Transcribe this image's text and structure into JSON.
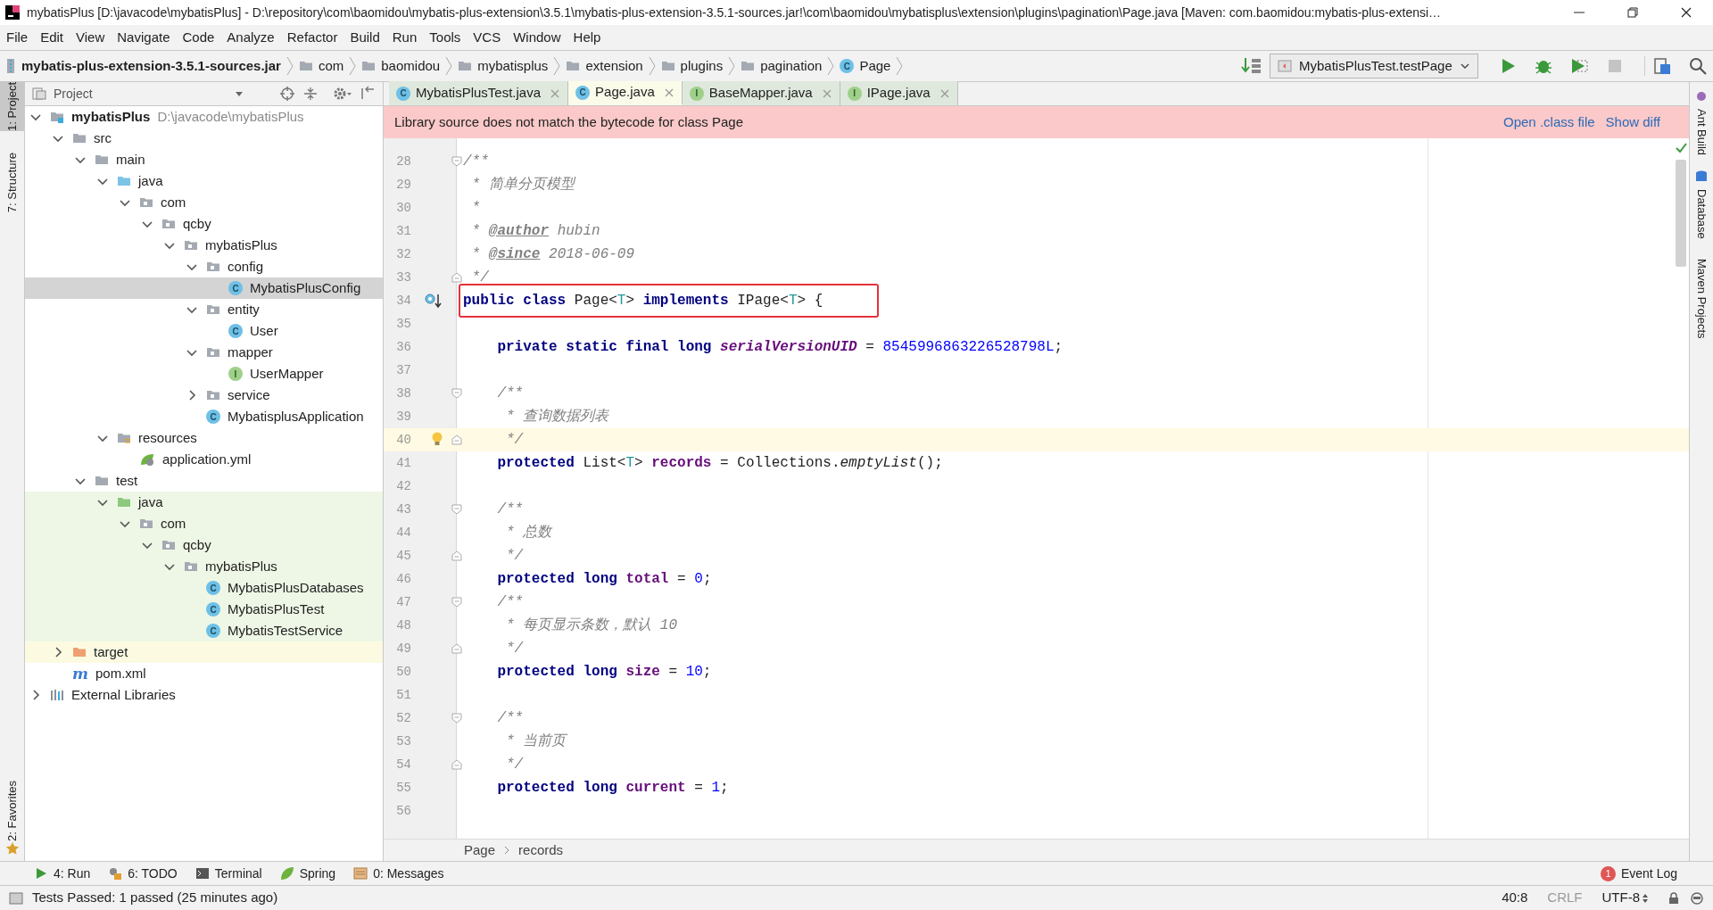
{
  "window": {
    "title": "mybatisPlus [D:\\javacode\\mybatisPlus] - D:\\repository\\com\\baomidou\\mybatis-plus-extension\\3.5.1\\mybatis-plus-extension-3.5.1-sources.jar!\\com\\baomidou\\mybatisplus\\extension\\plugins\\pagination\\Page.java [Maven: com.baomidou:mybatis-plus-extensi…"
  },
  "menu": [
    "File",
    "Edit",
    "View",
    "Navigate",
    "Code",
    "Analyze",
    "Refactor",
    "Build",
    "Run",
    "Tools",
    "VCS",
    "Window",
    "Help"
  ],
  "nav_bar": {
    "items": [
      {
        "label": "mybatis-plus-extension-3.5.1-sources.jar",
        "kind": "jar"
      },
      {
        "label": "com",
        "kind": "folder"
      },
      {
        "label": "baomidou",
        "kind": "folder"
      },
      {
        "label": "mybatisplus",
        "kind": "folder"
      },
      {
        "label": "extension",
        "kind": "folder"
      },
      {
        "label": "plugins",
        "kind": "folder"
      },
      {
        "label": "pagination",
        "kind": "folder"
      },
      {
        "label": "Page",
        "kind": "class",
        "icon_letter": "C"
      }
    ],
    "run_config": "MybatisPlusTest.testPage"
  },
  "left_strip": {
    "top": [
      {
        "label": "1: Project",
        "selected": true
      },
      {
        "label": "7: Structure",
        "selected": false
      }
    ],
    "bottom": [
      {
        "label": "2: Favorites",
        "selected": false
      }
    ]
  },
  "project_panel": {
    "title": "Project",
    "tree": [
      {
        "label": "mybatisPlus",
        "hint": "D:\\javacode\\mybatisPlus",
        "kind": "module",
        "expanded": true,
        "selected": false,
        "children": [
          {
            "label": "src",
            "kind": "folder",
            "expanded": true,
            "selected": false,
            "children": [
              {
                "label": "main",
                "kind": "folder",
                "expanded": true,
                "selected": false,
                "children": [
                  {
                    "label": "java",
                    "kind": "source-folder",
                    "expanded": true,
                    "selected": false,
                    "children": [
                      {
                        "label": "com",
                        "kind": "package",
                        "expanded": true,
                        "selected": false,
                        "children": [
                          {
                            "label": "qcby",
                            "kind": "package",
                            "expanded": true,
                            "selected": false,
                            "children": [
                              {
                                "label": "mybatisPlus",
                                "kind": "package",
                                "expanded": true,
                                "selected": false,
                                "children": [
                                  {
                                    "label": "config",
                                    "kind": "package",
                                    "expanded": true,
                                    "selected": false,
                                    "children": [
                                      {
                                        "label": "MybatisPlusConfig",
                                        "kind": "class",
                                        "icon_letter": "C",
                                        "selected": true
                                      }
                                    ]
                                  },
                                  {
                                    "label": "entity",
                                    "kind": "package",
                                    "expanded": true,
                                    "selected": false,
                                    "children": [
                                      {
                                        "label": "User",
                                        "kind": "class",
                                        "icon_letter": "C",
                                        "selected": false
                                      }
                                    ]
                                  },
                                  {
                                    "label": "mapper",
                                    "kind": "package",
                                    "expanded": true,
                                    "selected": false,
                                    "children": [
                                      {
                                        "label": "UserMapper",
                                        "kind": "interface",
                                        "icon_letter": "I",
                                        "selected": false
                                      }
                                    ]
                                  },
                                  {
                                    "label": "service",
                                    "kind": "package",
                                    "expanded": false,
                                    "selected": false
                                  },
                                  {
                                    "label": "MybatisplusApplication",
                                    "kind": "spring-class",
                                    "icon_letter": "C",
                                    "selected": false
                                  }
                                ]
                              }
                            ]
                          }
                        ]
                      }
                    ]
                  },
                  {
                    "label": "resources",
                    "kind": "resources-folder",
                    "expanded": true,
                    "selected": false,
                    "children": [
                      {
                        "label": "application.yml",
                        "kind": "yml",
                        "selected": false
                      }
                    ]
                  }
                ]
              },
              {
                "label": "test",
                "kind": "folder",
                "expanded": true,
                "selected": false,
                "children": [
                  {
                    "label": "java",
                    "kind": "test-folder",
                    "expanded": true,
                    "selected": false,
                    "test_scope": true,
                    "children": [
                      {
                        "label": "com",
                        "kind": "package",
                        "expanded": true,
                        "selected": false,
                        "test_scope": true,
                        "children": [
                          {
                            "label": "qcby",
                            "kind": "package",
                            "expanded": true,
                            "selected": false,
                            "test_scope": true,
                            "children": [
                              {
                                "label": "mybatisPlus",
                                "kind": "package",
                                "expanded": true,
                                "selected": false,
                                "test_scope": true,
                                "children": [
                                  {
                                    "label": "MybatisPlusDatabases",
                                    "kind": "test-class",
                                    "icon_letter": "C",
                                    "selected": false,
                                    "test_scope": true
                                  },
                                  {
                                    "label": "MybatisPlusTest",
                                    "kind": "test-class",
                                    "icon_letter": "C",
                                    "selected": false,
                                    "test_scope": true
                                  },
                                  {
                                    "label": "MybatisTestService",
                                    "kind": "test-class",
                                    "icon_letter": "C",
                                    "selected": false,
                                    "test_scope": true
                                  }
                                ]
                              }
                            ]
                          }
                        ]
                      }
                    ]
                  }
                ]
              }
            ]
          },
          {
            "label": "target",
            "kind": "excluded-folder",
            "expanded": false,
            "selected": false,
            "excluded": true
          },
          {
            "label": "pom.xml",
            "kind": "maven",
            "icon_letter": "m",
            "selected": false
          }
        ]
      },
      {
        "label": "External Libraries",
        "kind": "libraries",
        "expanded": false,
        "selected": false
      }
    ]
  },
  "editor": {
    "tabs": [
      {
        "label": "MybatisPlusTest.java",
        "kind": "test-class",
        "icon_letter": "C",
        "selected": false
      },
      {
        "label": "Page.java",
        "kind": "class",
        "icon_letter": "C",
        "selected": true
      },
      {
        "label": "BaseMapper.java",
        "kind": "interface",
        "icon_letter": "I",
        "selected": false
      },
      {
        "label": "IPage.java",
        "kind": "interface",
        "icon_letter": "I",
        "selected": false
      }
    ],
    "banner": {
      "message": "Library source does not match the bytecode for class Page",
      "links": [
        "Open .class file",
        "Show diff"
      ]
    },
    "lines": [
      {
        "n": "28",
        "current": false,
        "boxed": false,
        "fold_start": true,
        "tokens": [
          {
            "kind": "comment",
            "t": "/**"
          }
        ]
      },
      {
        "n": "29",
        "current": false,
        "boxed": false,
        "tokens": [
          {
            "kind": "comment",
            "t": " * 简单分页模型"
          }
        ]
      },
      {
        "n": "30",
        "current": false,
        "boxed": false,
        "tokens": [
          {
            "kind": "comment",
            "t": " *"
          }
        ]
      },
      {
        "n": "31",
        "current": false,
        "boxed": false,
        "tokens": [
          {
            "kind": "comment",
            "t": " * "
          },
          {
            "kind": "doc_tag",
            "t": "@author"
          },
          {
            "kind": "comment",
            "t": " hubin"
          }
        ]
      },
      {
        "n": "32",
        "current": false,
        "boxed": false,
        "tokens": [
          {
            "kind": "comment",
            "t": " * "
          },
          {
            "kind": "doc_tag",
            "t": "@since"
          },
          {
            "kind": "comment",
            "t": " 2018-06-09"
          }
        ]
      },
      {
        "n": "33",
        "current": false,
        "boxed": false,
        "fold_end": true,
        "tokens": [
          {
            "kind": "comment",
            "t": " */"
          }
        ]
      },
      {
        "n": "34",
        "current": false,
        "boxed": true,
        "implements_marker": true,
        "tokens": [
          {
            "kind": "kw",
            "t": "public class"
          },
          {
            "kind": "plain",
            "t": " Page<"
          },
          {
            "kind": "type_param",
            "t": "T"
          },
          {
            "kind": "plain",
            "t": "> "
          },
          {
            "kind": "kw",
            "t": "implements"
          },
          {
            "kind": "plain",
            "t": " IPage<"
          },
          {
            "kind": "type_param",
            "t": "T"
          },
          {
            "kind": "plain",
            "t": "> {"
          }
        ]
      },
      {
        "n": "35",
        "current": false,
        "boxed": false
      },
      {
        "n": "36",
        "current": false,
        "boxed": false,
        "tokens": [
          {
            "kind": "kw",
            "t": "    private static final long "
          },
          {
            "kind": "static_field",
            "t": "serialVersionUID"
          },
          {
            "kind": "plain",
            "t": " = "
          },
          {
            "kind": "num",
            "t": "8545996863226528798L"
          },
          {
            "kind": "plain",
            "t": ";"
          }
        ]
      },
      {
        "n": "37",
        "current": false,
        "boxed": false
      },
      {
        "n": "38",
        "current": false,
        "boxed": false,
        "fold_start": true,
        "tokens": [
          {
            "kind": "comment",
            "t": "    /**"
          }
        ]
      },
      {
        "n": "39",
        "current": false,
        "boxed": false,
        "tokens": [
          {
            "kind": "comment",
            "t": "     * 查询数据列表"
          }
        ]
      },
      {
        "n": "40",
        "current": true,
        "boxed": false,
        "fold_end": true,
        "intention_bulb": true,
        "tokens": [
          {
            "kind": "comment",
            "t": "     */"
          }
        ]
      },
      {
        "n": "41",
        "current": false,
        "boxed": false,
        "tokens": [
          {
            "kind": "kw",
            "t": "    protected"
          },
          {
            "kind": "plain",
            "t": " List<"
          },
          {
            "kind": "type_param",
            "t": "T"
          },
          {
            "kind": "plain",
            "t": "> "
          },
          {
            "kind": "field",
            "t": "records"
          },
          {
            "kind": "plain",
            "t": " = Collections."
          },
          {
            "kind": "static_method",
            "t": "emptyList"
          },
          {
            "kind": "plain",
            "t": "();"
          }
        ]
      },
      {
        "n": "42",
        "current": false,
        "boxed": false
      },
      {
        "n": "43",
        "current": false,
        "boxed": false,
        "fold_start": true,
        "tokens": [
          {
            "kind": "comment",
            "t": "    /**"
          }
        ]
      },
      {
        "n": "44",
        "current": false,
        "boxed": false,
        "tokens": [
          {
            "kind": "comment",
            "t": "     * 总数"
          }
        ]
      },
      {
        "n": "45",
        "current": false,
        "boxed": false,
        "fold_end": true,
        "tokens": [
          {
            "kind": "comment",
            "t": "     */"
          }
        ]
      },
      {
        "n": "46",
        "current": false,
        "boxed": false,
        "tokens": [
          {
            "kind": "kw",
            "t": "    protected long "
          },
          {
            "kind": "field",
            "t": "total"
          },
          {
            "kind": "plain",
            "t": " = "
          },
          {
            "kind": "num",
            "t": "0"
          },
          {
            "kind": "plain",
            "t": ";"
          }
        ]
      },
      {
        "n": "47",
        "current": false,
        "boxed": false,
        "fold_start": true,
        "tokens": [
          {
            "kind": "comment",
            "t": "    /**"
          }
        ]
      },
      {
        "n": "48",
        "current": false,
        "boxed": false,
        "tokens": [
          {
            "kind": "comment",
            "t": "     * 每页显示条数，默认 10"
          }
        ]
      },
      {
        "n": "49",
        "current": false,
        "boxed": false,
        "fold_end": true,
        "tokens": [
          {
            "kind": "comment",
            "t": "     */"
          }
        ]
      },
      {
        "n": "50",
        "current": false,
        "boxed": false,
        "tokens": [
          {
            "kind": "kw",
            "t": "    protected long "
          },
          {
            "kind": "field",
            "t": "size"
          },
          {
            "kind": "plain",
            "t": " = "
          },
          {
            "kind": "num",
            "t": "10"
          },
          {
            "kind": "plain",
            "t": ";"
          }
        ]
      },
      {
        "n": "51",
        "current": false,
        "boxed": false
      },
      {
        "n": "52",
        "current": false,
        "boxed": false,
        "fold_start": true,
        "tokens": [
          {
            "kind": "comment",
            "t": "    /**"
          }
        ]
      },
      {
        "n": "53",
        "current": false,
        "boxed": false,
        "tokens": [
          {
            "kind": "comment",
            "t": "     * 当前页"
          }
        ]
      },
      {
        "n": "54",
        "current": false,
        "boxed": false,
        "fold_end": true,
        "tokens": [
          {
            "kind": "comment",
            "t": "     */"
          }
        ]
      },
      {
        "n": "55",
        "current": false,
        "boxed": false,
        "tokens": [
          {
            "kind": "kw",
            "t": "    protected long "
          },
          {
            "kind": "field",
            "t": "current"
          },
          {
            "kind": "plain",
            "t": " = "
          },
          {
            "kind": "num",
            "t": "1"
          },
          {
            "kind": "plain",
            "t": ";"
          }
        ]
      },
      {
        "n": "56",
        "current": false,
        "boxed": false
      }
    ],
    "breadcrumb": [
      "Page",
      "records"
    ]
  },
  "right_strip": [
    "Ant Build",
    "Database",
    "Maven Projects"
  ],
  "tool_windows": [
    {
      "label": "4: Run",
      "kind": "run"
    },
    {
      "label": "6: TODO",
      "kind": "todo"
    },
    {
      "label": "Terminal",
      "kind": "terminal"
    },
    {
      "label": "Spring",
      "kind": "spring"
    },
    {
      "label": "0: Messages",
      "kind": "messages"
    }
  ],
  "event_log": {
    "label": "Event Log",
    "count": "1"
  },
  "status_bar": {
    "message": "Tests Passed: 1 passed (25 minutes ago)",
    "position": "40:8",
    "line_separator": "CRLF",
    "encoding": "UTF-8"
  }
}
